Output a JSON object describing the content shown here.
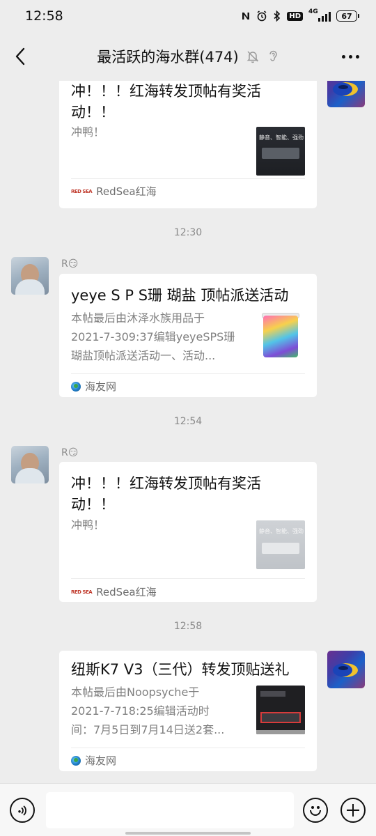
{
  "status_bar": {
    "time": "12:58",
    "icons": [
      "nfc-icon",
      "alarm-icon",
      "bluetooth-icon",
      "hd-icon",
      "signal-icon",
      "battery-icon"
    ],
    "hd_label": "HD",
    "network": "4G",
    "battery": "67"
  },
  "nav": {
    "title": "最活跃的海水群(474)"
  },
  "messages": [
    {
      "sender": "",
      "card": {
        "title_line1": "冲！！！红海转发顶帖有奖活",
        "title_line2": "动！！",
        "desc_line1": "冲鸭！",
        "desc_line2": "",
        "desc_line3": "",
        "source": "RedSea红海",
        "thumb_text": "静音、智能、强劲"
      }
    },
    {
      "timestamp": "12:30",
      "sender": "R😏",
      "card": {
        "title_line1": "yeye S P S珊 瑚盐 顶帖派送活动",
        "desc_line1": "本帖最后由沐泽水族用品于",
        "desc_line2": "2021-7-309:37编辑yeyeSPS珊",
        "desc_line3": "瑚盐顶帖派送活动一、活动...",
        "source": "海友网"
      }
    },
    {
      "timestamp": "12:54",
      "sender": "R😏",
      "card": {
        "title_line1": "冲！！！红海转发顶帖有奖活",
        "title_line2": "动！！",
        "desc_line1": "冲鸭！",
        "source": "RedSea红海",
        "thumb_text": "静音、智能、强劲"
      }
    },
    {
      "timestamp": "12:58",
      "card": {
        "title_line1": "纽斯K7 V3（三代）转发顶贴送礼",
        "desc_line1": "本帖最后由Noopsyche于",
        "desc_line2": "2021-7-718:25编辑活动时",
        "desc_line3": "间：7月5日到7月14日送2套...",
        "source": "海友网"
      }
    }
  ],
  "input": {
    "placeholder": "",
    "value": ""
  },
  "colors": {
    "background": "#ededed",
    "card": "#ffffff",
    "secondary_text": "#808080"
  }
}
